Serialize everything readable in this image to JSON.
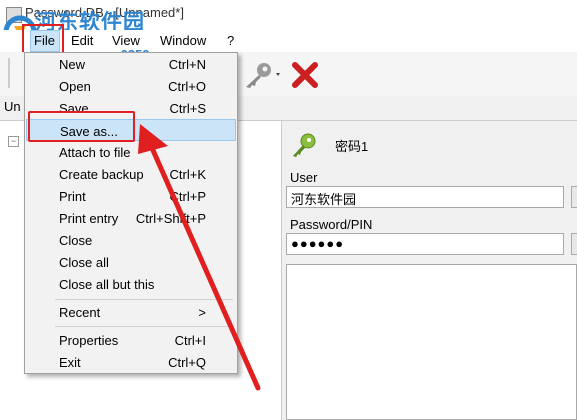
{
  "window": {
    "title": "Password DB - [Unnamed*]",
    "watermark": "河东软件园",
    "watermark_url": "www.pc0359.cn"
  },
  "menubar": {
    "items": [
      "File",
      "Edit",
      "View",
      "Window",
      "?"
    ]
  },
  "tab": {
    "label": "Un"
  },
  "file_menu": {
    "items": [
      {
        "label": "New",
        "shortcut": "Ctrl+N"
      },
      {
        "label": "Open",
        "shortcut": "Ctrl+O"
      },
      {
        "label": "Save",
        "shortcut": "Ctrl+S"
      },
      {
        "label": "Save as...",
        "shortcut": ""
      },
      {
        "label": "Attach to file",
        "shortcut": ""
      },
      {
        "label": "Create backup",
        "shortcut": "Ctrl+K"
      },
      {
        "label": "Print",
        "shortcut": "Ctrl+P"
      },
      {
        "label": "Print entry",
        "shortcut": "Ctrl+Shift+P"
      },
      {
        "label": "Close",
        "shortcut": ""
      },
      {
        "label": "Close all",
        "shortcut": ""
      },
      {
        "label": "Close all but this",
        "shortcut": ""
      },
      {
        "label": "Recent",
        "shortcut": ">"
      },
      {
        "label": "Properties",
        "shortcut": "Ctrl+I"
      },
      {
        "label": "Exit",
        "shortcut": "Ctrl+Q"
      }
    ]
  },
  "entry": {
    "title": "密码1",
    "user_label": "User",
    "user_value": "河东软件园",
    "password_label": "Password/PIN",
    "password_value": "●●●●●●"
  },
  "tree": {
    "expander": "−"
  },
  "colors": {
    "highlight_red": "#e02020",
    "selection": "#cce4f7",
    "watermark_blue": "#2f86d0"
  }
}
